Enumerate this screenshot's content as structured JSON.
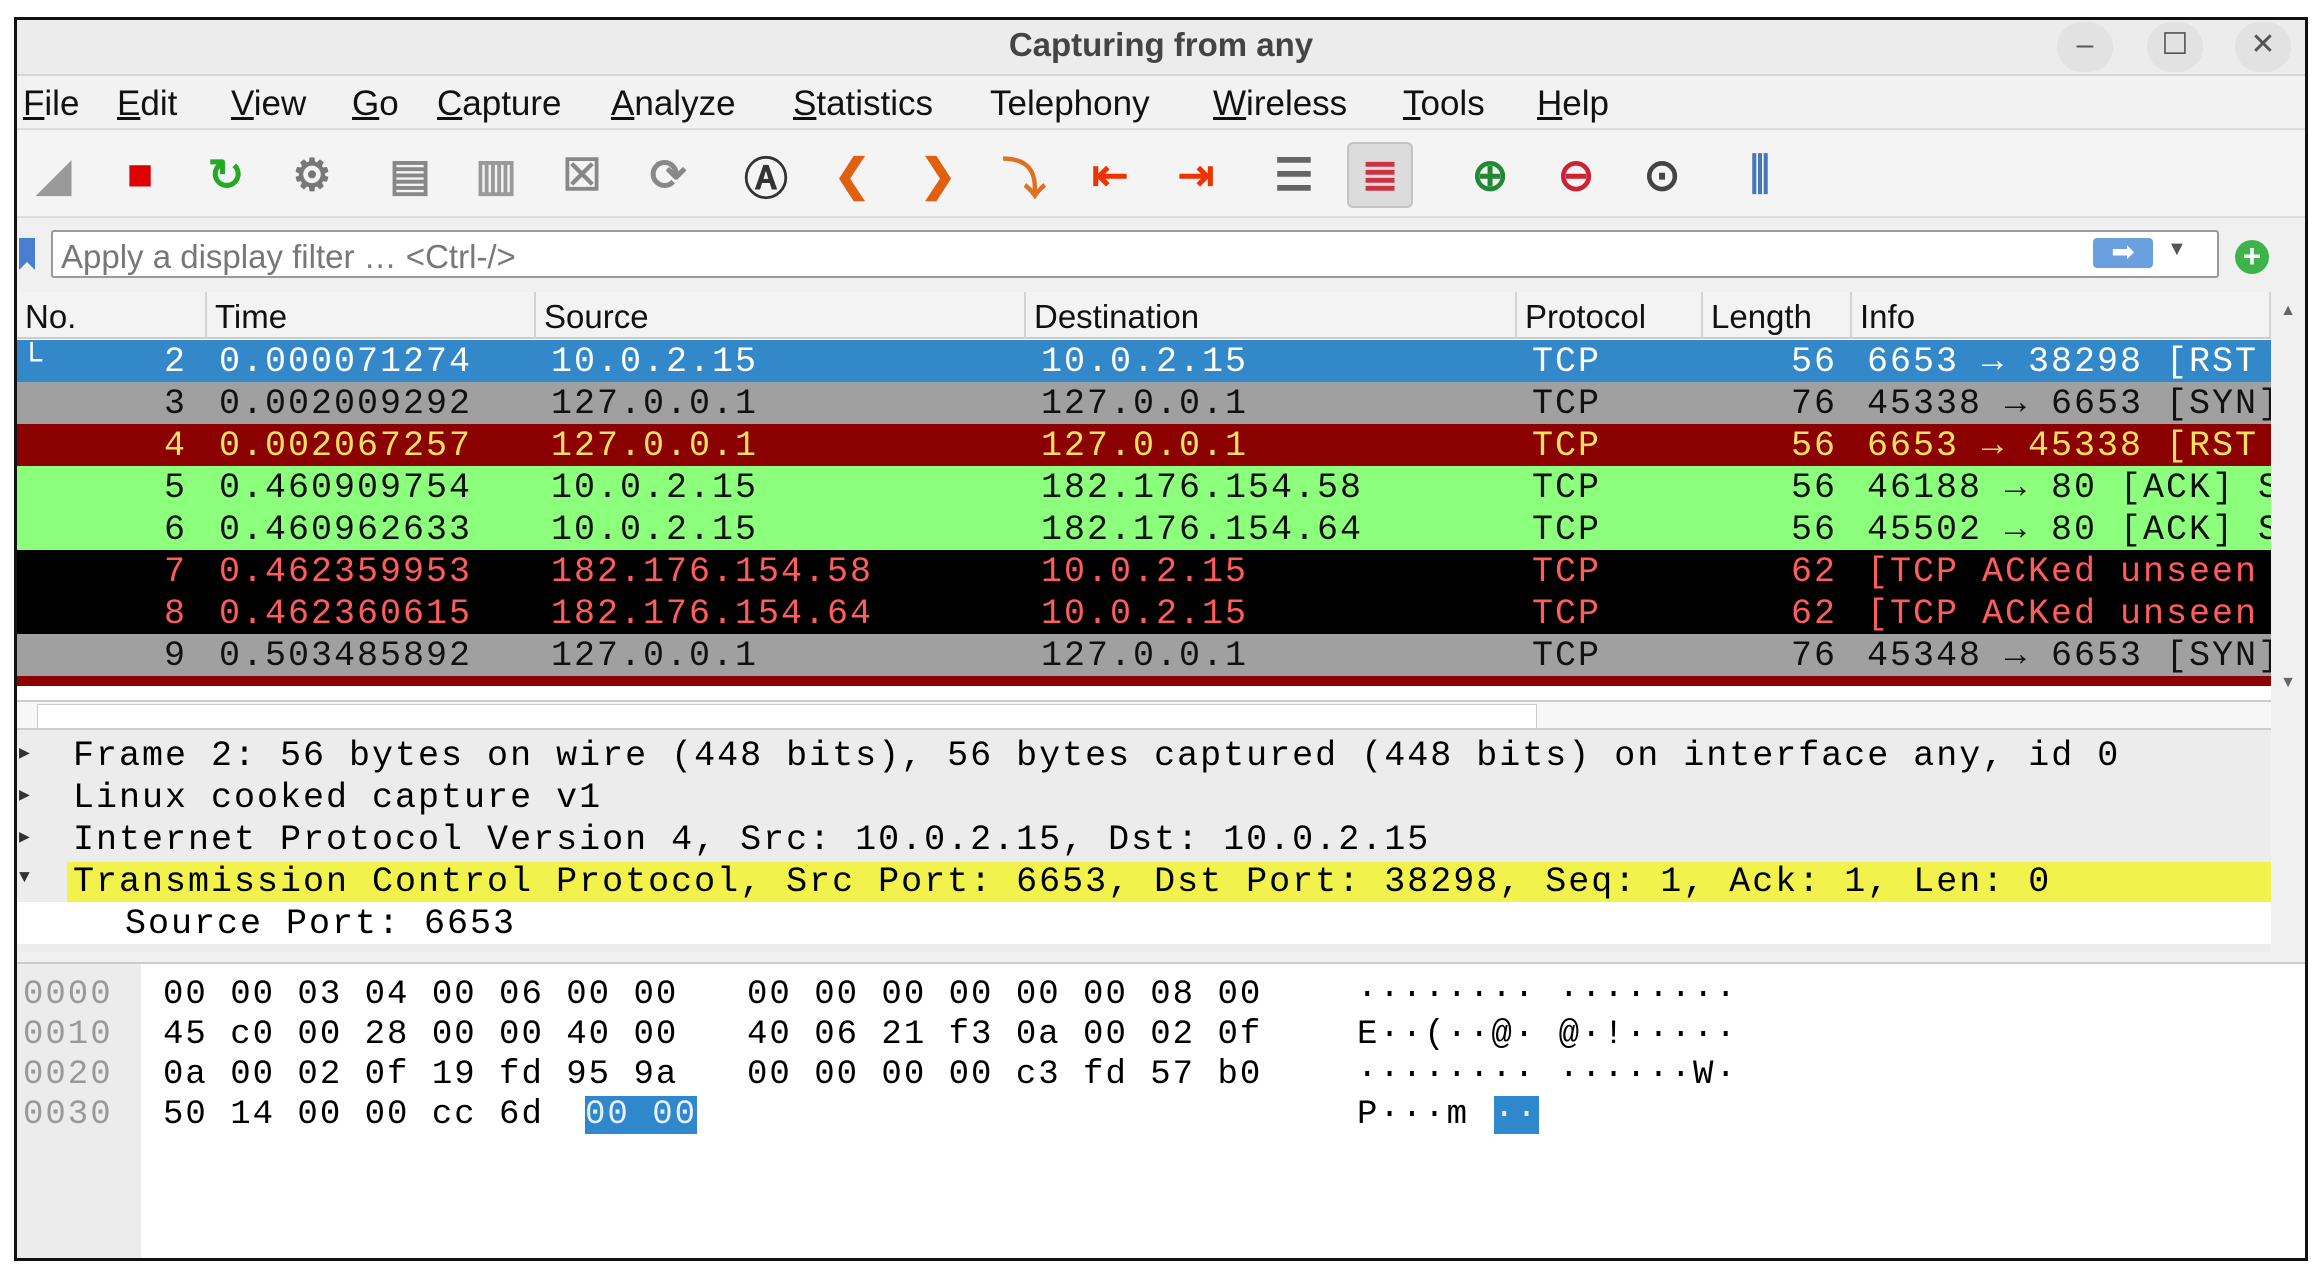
{
  "window": {
    "title": "Capturing from any",
    "controls": [
      "–",
      "☐",
      "✕"
    ]
  },
  "menu": [
    {
      "label": "File",
      "u": "F",
      "rest": "ile"
    },
    {
      "label": "Edit",
      "u": "E",
      "rest": "dit"
    },
    {
      "label": "View",
      "u": "V",
      "rest": "iew"
    },
    {
      "label": "Go",
      "u": "G",
      "rest": "o"
    },
    {
      "label": "Capture",
      "u": "C",
      "rest": "apture"
    },
    {
      "label": "Analyze",
      "u": "A",
      "rest": "nalyze"
    },
    {
      "label": "Statistics",
      "u": "S",
      "rest": "tatistics"
    },
    {
      "label": "Telephony",
      "u": "Telephon",
      "rest": "y",
      "uLast": true
    },
    {
      "label": "Wireless",
      "u": "W",
      "rest": "ireless"
    },
    {
      "label": "Tools",
      "u": "T",
      "rest": "ools"
    },
    {
      "label": "Help",
      "u": "H",
      "rest": "elp"
    }
  ],
  "toolbar": [
    "start-capture-icon",
    "stop-capture-icon",
    "restart-capture-icon",
    "capture-options-icon",
    "open-file-icon",
    "save-file-icon",
    "close-file-icon",
    "reload-file-icon",
    "find-packet-icon",
    "go-back-icon",
    "go-forward-icon",
    "go-to-packet-icon",
    "first-packet-icon",
    "last-packet-icon",
    "auto-scroll-icon",
    "colorize-icon",
    "zoom-in-icon",
    "zoom-out-icon",
    "normal-size-icon",
    "resize-columns-icon"
  ],
  "filter": {
    "placeholder": "Apply a display filter … <Ctrl-/>",
    "apply": "➡",
    "add": "+"
  },
  "packet_list": {
    "columns": [
      "No.",
      "Time",
      "Source",
      "Destination",
      "Protocol",
      "Length",
      "Info"
    ],
    "rows": [
      {
        "no": "2",
        "time": "0.000071274",
        "src": "10.0.2.15",
        "dst": "10.0.2.15",
        "proto": "TCP",
        "len": "56",
        "info": "6653 → 38298 [RST",
        "bg": "#3288c8",
        "fg": "#ffffff"
      },
      {
        "no": "3",
        "time": "0.002009292",
        "src": "127.0.0.1",
        "dst": "127.0.0.1",
        "proto": "TCP",
        "len": "76",
        "info": "45338 → 6653 [SYN]",
        "bg": "#a0a0a0",
        "fg": "#111111"
      },
      {
        "no": "4",
        "time": "0.002067257",
        "src": "127.0.0.1",
        "dst": "127.0.0.1",
        "proto": "TCP",
        "len": "56",
        "info": "6653 → 45338 [RST",
        "bg": "#8b0000",
        "fg": "#ffe060"
      },
      {
        "no": "5",
        "time": "0.460909754",
        "src": "10.0.2.15",
        "dst": "182.176.154.58",
        "proto": "TCP",
        "len": "56",
        "info": "46188 → 80 [ACK] S",
        "bg": "#8cff7c",
        "fg": "#111111"
      },
      {
        "no": "6",
        "time": "0.460962633",
        "src": "10.0.2.15",
        "dst": "182.176.154.64",
        "proto": "TCP",
        "len": "56",
        "info": "45502 → 80 [ACK] S",
        "bg": "#8cff7c",
        "fg": "#111111"
      },
      {
        "no": "7",
        "time": "0.462359953",
        "src": "182.176.154.58",
        "dst": "10.0.2.15",
        "proto": "TCP",
        "len": "62",
        "info": "[TCP ACKed unseen",
        "bg": "#000000",
        "fg": "#ff5c5c"
      },
      {
        "no": "8",
        "time": "0.462360615",
        "src": "182.176.154.64",
        "dst": "10.0.2.15",
        "proto": "TCP",
        "len": "62",
        "info": "[TCP ACKed unseen",
        "bg": "#000000",
        "fg": "#ff5c5c"
      },
      {
        "no": "9",
        "time": "0.503485892",
        "src": "127.0.0.1",
        "dst": "127.0.0.1",
        "proto": "TCP",
        "len": "76",
        "info": "45348 → 6653 [SYN]",
        "bg": "#a0a0a0",
        "fg": "#111111"
      }
    ]
  },
  "details": [
    {
      "text": "Frame 2: 56 bytes on wire (448 bits), 56 bytes captured (448 bits) on interface any, id 0",
      "state": "collapsed"
    },
    {
      "text": "Linux cooked capture v1",
      "state": "collapsed"
    },
    {
      "text": "Internet Protocol Version 4, Src: 10.0.2.15, Dst: 10.0.2.15",
      "state": "collapsed"
    },
    {
      "text": "Transmission Control Protocol, Src Port: 6653, Dst Port: 38298, Seq: 1, Ack: 1, Len: 0",
      "state": "expanded",
      "highlight": "#f2f24c"
    },
    {
      "text": "Source Port: 6653",
      "state": "child"
    }
  ],
  "hex": [
    {
      "off": "0000",
      "a": "00 00 03 04 00 06 00 00",
      "b": "00 00 00 00 00 00 08 00",
      "ascii": "········ ········"
    },
    {
      "off": "0010",
      "a": "45 c0 00 28 00 00 40 00",
      "b": "40 06 21 f3 0a 00 02 0f",
      "ascii": "E··(··@· @·!·····"
    },
    {
      "off": "0020",
      "a": "0a 00 02 0f 19 fd 95 9a",
      "b": "00 00 00 00 c3 fd 57 b0",
      "ascii": "········ ······W·"
    },
    {
      "off": "0030",
      "a": "50 14 00 00 cc 6d",
      "a_sel": "00 00",
      "b": "",
      "ascii": "P···m",
      "ascii_sel": "··"
    }
  ]
}
